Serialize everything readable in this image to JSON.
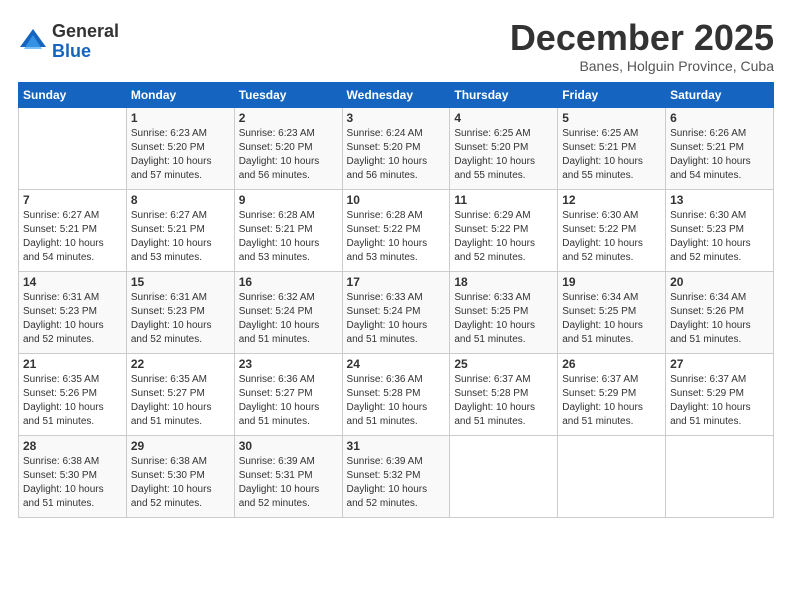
{
  "header": {
    "logo_general": "General",
    "logo_blue": "Blue",
    "month_title": "December 2025",
    "location": "Banes, Holguin Province, Cuba"
  },
  "days_of_week": [
    "Sunday",
    "Monday",
    "Tuesday",
    "Wednesday",
    "Thursday",
    "Friday",
    "Saturday"
  ],
  "weeks": [
    [
      {
        "day": "",
        "info": ""
      },
      {
        "day": "1",
        "info": "Sunrise: 6:23 AM\nSunset: 5:20 PM\nDaylight: 10 hours\nand 57 minutes."
      },
      {
        "day": "2",
        "info": "Sunrise: 6:23 AM\nSunset: 5:20 PM\nDaylight: 10 hours\nand 56 minutes."
      },
      {
        "day": "3",
        "info": "Sunrise: 6:24 AM\nSunset: 5:20 PM\nDaylight: 10 hours\nand 56 minutes."
      },
      {
        "day": "4",
        "info": "Sunrise: 6:25 AM\nSunset: 5:20 PM\nDaylight: 10 hours\nand 55 minutes."
      },
      {
        "day": "5",
        "info": "Sunrise: 6:25 AM\nSunset: 5:21 PM\nDaylight: 10 hours\nand 55 minutes."
      },
      {
        "day": "6",
        "info": "Sunrise: 6:26 AM\nSunset: 5:21 PM\nDaylight: 10 hours\nand 54 minutes."
      }
    ],
    [
      {
        "day": "7",
        "info": "Sunrise: 6:27 AM\nSunset: 5:21 PM\nDaylight: 10 hours\nand 54 minutes."
      },
      {
        "day": "8",
        "info": "Sunrise: 6:27 AM\nSunset: 5:21 PM\nDaylight: 10 hours\nand 53 minutes."
      },
      {
        "day": "9",
        "info": "Sunrise: 6:28 AM\nSunset: 5:21 PM\nDaylight: 10 hours\nand 53 minutes."
      },
      {
        "day": "10",
        "info": "Sunrise: 6:28 AM\nSunset: 5:22 PM\nDaylight: 10 hours\nand 53 minutes."
      },
      {
        "day": "11",
        "info": "Sunrise: 6:29 AM\nSunset: 5:22 PM\nDaylight: 10 hours\nand 52 minutes."
      },
      {
        "day": "12",
        "info": "Sunrise: 6:30 AM\nSunset: 5:22 PM\nDaylight: 10 hours\nand 52 minutes."
      },
      {
        "day": "13",
        "info": "Sunrise: 6:30 AM\nSunset: 5:23 PM\nDaylight: 10 hours\nand 52 minutes."
      }
    ],
    [
      {
        "day": "14",
        "info": "Sunrise: 6:31 AM\nSunset: 5:23 PM\nDaylight: 10 hours\nand 52 minutes."
      },
      {
        "day": "15",
        "info": "Sunrise: 6:31 AM\nSunset: 5:23 PM\nDaylight: 10 hours\nand 52 minutes."
      },
      {
        "day": "16",
        "info": "Sunrise: 6:32 AM\nSunset: 5:24 PM\nDaylight: 10 hours\nand 51 minutes."
      },
      {
        "day": "17",
        "info": "Sunrise: 6:33 AM\nSunset: 5:24 PM\nDaylight: 10 hours\nand 51 minutes."
      },
      {
        "day": "18",
        "info": "Sunrise: 6:33 AM\nSunset: 5:25 PM\nDaylight: 10 hours\nand 51 minutes."
      },
      {
        "day": "19",
        "info": "Sunrise: 6:34 AM\nSunset: 5:25 PM\nDaylight: 10 hours\nand 51 minutes."
      },
      {
        "day": "20",
        "info": "Sunrise: 6:34 AM\nSunset: 5:26 PM\nDaylight: 10 hours\nand 51 minutes."
      }
    ],
    [
      {
        "day": "21",
        "info": "Sunrise: 6:35 AM\nSunset: 5:26 PM\nDaylight: 10 hours\nand 51 minutes."
      },
      {
        "day": "22",
        "info": "Sunrise: 6:35 AM\nSunset: 5:27 PM\nDaylight: 10 hours\nand 51 minutes."
      },
      {
        "day": "23",
        "info": "Sunrise: 6:36 AM\nSunset: 5:27 PM\nDaylight: 10 hours\nand 51 minutes."
      },
      {
        "day": "24",
        "info": "Sunrise: 6:36 AM\nSunset: 5:28 PM\nDaylight: 10 hours\nand 51 minutes."
      },
      {
        "day": "25",
        "info": "Sunrise: 6:37 AM\nSunset: 5:28 PM\nDaylight: 10 hours\nand 51 minutes."
      },
      {
        "day": "26",
        "info": "Sunrise: 6:37 AM\nSunset: 5:29 PM\nDaylight: 10 hours\nand 51 minutes."
      },
      {
        "day": "27",
        "info": "Sunrise: 6:37 AM\nSunset: 5:29 PM\nDaylight: 10 hours\nand 51 minutes."
      }
    ],
    [
      {
        "day": "28",
        "info": "Sunrise: 6:38 AM\nSunset: 5:30 PM\nDaylight: 10 hours\nand 51 minutes."
      },
      {
        "day": "29",
        "info": "Sunrise: 6:38 AM\nSunset: 5:30 PM\nDaylight: 10 hours\nand 52 minutes."
      },
      {
        "day": "30",
        "info": "Sunrise: 6:39 AM\nSunset: 5:31 PM\nDaylight: 10 hours\nand 52 minutes."
      },
      {
        "day": "31",
        "info": "Sunrise: 6:39 AM\nSunset: 5:32 PM\nDaylight: 10 hours\nand 52 minutes."
      },
      {
        "day": "",
        "info": ""
      },
      {
        "day": "",
        "info": ""
      },
      {
        "day": "",
        "info": ""
      }
    ]
  ]
}
